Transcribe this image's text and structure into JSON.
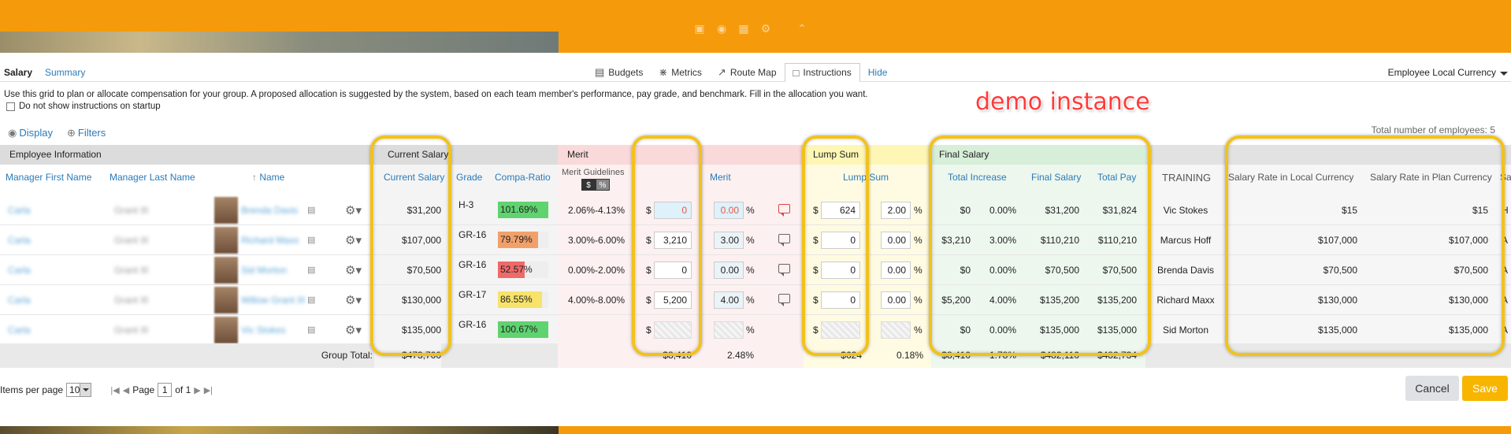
{
  "top_icons": [
    "document-icon",
    "globe-icon",
    "grid-icon",
    "gear-icon",
    "chevron-up-icon"
  ],
  "tabs": {
    "salary": "Salary",
    "summary": "Summary"
  },
  "toolbar": {
    "budgets": "Budgets",
    "metrics": "Metrics",
    "route_map": "Route Map",
    "instructions": "Instructions",
    "hide": "Hide"
  },
  "currency": "Employee Local Currency",
  "instructions_text": "Use this grid to plan or allocate compensation for your group. A proposed allocation is suggested by the system, based on each team member's performance, pay grade, and benchmark. Fill in the allocation you want.",
  "startup_label": "Do not show instructions on startup",
  "demo_label": "demo instance",
  "display_link": "Display",
  "filters_link": "Filters",
  "total_employees": "Total number of employees: 5",
  "groups": {
    "employee_info": "Employee Information",
    "current_salary": "Current Salary",
    "merit": "Merit",
    "lump_sum": "Lump Sum",
    "final_salary": "Final Salary"
  },
  "columns": {
    "manager_first": "Manager First Name",
    "manager_last": "Manager Last Name",
    "name": "Name",
    "current_salary": "Current Salary",
    "grade": "Grade",
    "compa": "Compa-Ratio",
    "merit_guidelines": "Merit Guidelines",
    "merit": "Merit",
    "lump_sum": "Lump Sum",
    "total_increase": "Total Increase",
    "final_salary": "Final Salary",
    "total_pay": "Total Pay",
    "training": "TRAINING",
    "rate_local": "Salary Rate in Local Currency",
    "rate_plan": "Salary Rate in Plan Currency",
    "sa": "Sa"
  },
  "toggle": {
    "dollar": "$",
    "percent": "%"
  },
  "rows": [
    {
      "mgr_first": "Carla",
      "mgr_last": "Grant III",
      "name": "Brenda Davis",
      "salary": "$31,200",
      "grade": "H-3",
      "compa": "101.69%",
      "compa_color": "#5fd36f",
      "compa_fill": 1.0,
      "guideline": "2.06%-4.13%",
      "merit_amt": "0",
      "merit_pct": "0.00",
      "lump_amt": "624",
      "lump_pct": "2.00",
      "inc_amt": "$0",
      "inc_pct": "0.00%",
      "final": "$31,200",
      "total_pay": "$31,824",
      "training": "Vic Stokes",
      "rate_local": "$15",
      "rate_plan": "$15",
      "sa": "H"
    },
    {
      "mgr_first": "Carla",
      "mgr_last": "Grant III",
      "name": "Richard Maxx",
      "salary": "$107,000",
      "grade": "GR-16",
      "compa": "79.79%",
      "compa_color": "#f2a06a",
      "compa_fill": 0.8,
      "guideline": "3.00%-6.00%",
      "merit_amt": "3,210",
      "merit_pct": "3.00",
      "lump_amt": "0",
      "lump_pct": "0.00",
      "inc_amt": "$3,210",
      "inc_pct": "3.00%",
      "final": "$110,210",
      "total_pay": "$110,210",
      "training": "Marcus Hoff",
      "rate_local": "$107,000",
      "rate_plan": "$107,000",
      "sa": "A"
    },
    {
      "mgr_first": "Carla",
      "mgr_last": "Grant III",
      "name": "Sid Morton",
      "salary": "$70,500",
      "grade": "GR-16",
      "compa": "52.57%",
      "compa_color": "#ee6a6a",
      "compa_fill": 0.53,
      "guideline": "0.00%-2.00%",
      "merit_amt": "0",
      "merit_pct": "0.00",
      "lump_amt": "0",
      "lump_pct": "0.00",
      "inc_amt": "$0",
      "inc_pct": "0.00%",
      "final": "$70,500",
      "total_pay": "$70,500",
      "training": "Brenda Davis",
      "rate_local": "$70,500",
      "rate_plan": "$70,500",
      "sa": "A"
    },
    {
      "mgr_first": "Carla",
      "mgr_last": "Grant III",
      "name": "Willow Grant III",
      "salary": "$130,000",
      "grade": "GR-17",
      "compa": "86.55%",
      "compa_color": "#f7e36a",
      "compa_fill": 0.87,
      "guideline": "4.00%-8.00%",
      "merit_amt": "5,200",
      "merit_pct": "4.00",
      "lump_amt": "0",
      "lump_pct": "0.00",
      "inc_amt": "$5,200",
      "inc_pct": "4.00%",
      "final": "$135,200",
      "total_pay": "$135,200",
      "training": "Richard Maxx",
      "rate_local": "$130,000",
      "rate_plan": "$130,000",
      "sa": "A"
    },
    {
      "mgr_first": "Carla",
      "mgr_last": "Grant III",
      "name": "Vic Stokes",
      "salary": "$135,000",
      "grade": "GR-16",
      "compa": "100.67%",
      "compa_color": "#5fd36f",
      "compa_fill": 1.0,
      "guideline": "",
      "merit_amt": "",
      "merit_pct": "",
      "lump_amt": "",
      "lump_pct": "",
      "inc_amt": "$0",
      "inc_pct": "0.00%",
      "final": "$135,000",
      "total_pay": "$135,000",
      "training": "Sid Morton",
      "rate_local": "$135,000",
      "rate_plan": "$135,000",
      "sa": "A"
    }
  ],
  "totals": {
    "label": "Group Total:",
    "salary": "$473,700",
    "merit_amt": "$8,410",
    "merit_pct": "2.48%",
    "lump_amt": "$624",
    "lump_pct": "0.18%",
    "inc_amt": "$8,410",
    "inc_pct": "1.78%",
    "final": "$482,110",
    "total_pay": "$482,734"
  },
  "pager": {
    "items_label": "Items per page",
    "items_value": "10",
    "page_label": "Page",
    "page_value": "1",
    "of_label": "of 1"
  },
  "buttons": {
    "cancel": "Cancel",
    "save": "Save"
  }
}
